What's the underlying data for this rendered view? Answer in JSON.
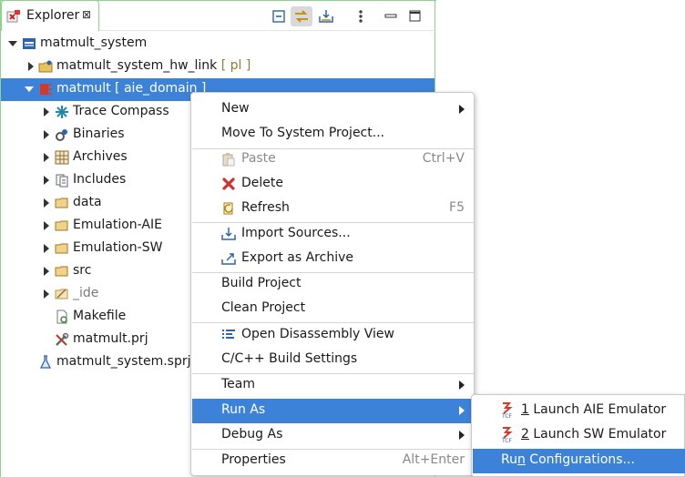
{
  "view": {
    "tab_title": "Explorer",
    "tab_close": "⊠"
  },
  "tree": [
    {
      "label": "matmult_system",
      "suffix": "",
      "icon": "system-project-icon"
    },
    {
      "label": "matmult_system_hw_link",
      "suffix": " [ pl ]",
      "icon": "hw-link-folder-icon"
    },
    {
      "label": "matmult",
      "suffix": " [ aie_domain ]",
      "icon": "aie-project-icon"
    },
    {
      "label": "Trace Compass",
      "icon": "trace-compass-icon"
    },
    {
      "label": "Binaries",
      "icon": "binaries-icon"
    },
    {
      "label": "Archives",
      "icon": "archives-icon"
    },
    {
      "label": "Includes",
      "icon": "includes-icon"
    },
    {
      "label": "data",
      "icon": "folder-icon"
    },
    {
      "label": "Emulation-AIE",
      "icon": "folder-icon"
    },
    {
      "label": "Emulation-SW",
      "icon": "folder-icon"
    },
    {
      "label": "src",
      "icon": "folder-icon"
    },
    {
      "label": "_ide",
      "icon": "folder-icon"
    },
    {
      "label": "Makefile",
      "icon": "makefile-icon"
    },
    {
      "label": "matmult.prj",
      "icon": "prj-file-icon"
    },
    {
      "label": "matmult_system.sprj",
      "icon": "sprj-file-icon"
    }
  ],
  "menu": {
    "new": "New",
    "move_to_system": "Move To System Project...",
    "paste": "Paste",
    "paste_acc": "Ctrl+V",
    "delete": "Delete",
    "refresh": "Refresh",
    "refresh_acc": "F5",
    "import_sources": "Import Sources...",
    "export_archive": "Export as Archive",
    "build_project": "Build Project",
    "clean_project": "Clean Project",
    "open_disassembly": "Open Disassembly View",
    "build_settings": "C/C++ Build Settings",
    "team": "Team",
    "run_as": "Run As",
    "debug_as": "Debug As",
    "properties": "Properties",
    "properties_acc": "Alt+Enter"
  },
  "submenu": {
    "launch_aie_num": "1",
    "launch_aie": " Launch AIE Emulator",
    "launch_sw_num": "2",
    "launch_sw": " Launch SW Emulator",
    "run_config_pre": "Ru",
    "run_config_u": "n",
    "run_config_post": " Configurations..."
  },
  "colors": {
    "selection": "#3d82d9",
    "view_border": "#8fd28c"
  }
}
